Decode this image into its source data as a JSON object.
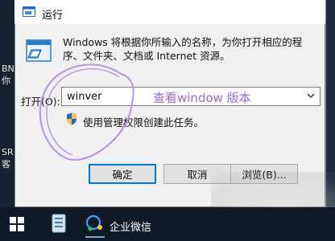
{
  "background": {
    "left_fragments": [
      "BN",
      "你",
      "SR",
      "客"
    ]
  },
  "dialog": {
    "title": "运行",
    "description": "Windows 将根据你所输入的名称，为你打开相应的程序、文件夹、文档或 Internet 资源。",
    "open_label": "打开(O):",
    "input_value": "winver",
    "admin_note": "使用管理权限创建此任务。",
    "buttons": {
      "ok": "确定",
      "cancel": "取消",
      "browse": "浏览(B)..."
    }
  },
  "annotation": {
    "text": "查看window 版本",
    "color": "#9b6bd3"
  },
  "taskbar": {
    "wecom_label": "企业微信"
  },
  "icons": [
    "run-title-icon",
    "run-app-icon",
    "dropdown-arrow-icon",
    "uac-shield-icon",
    "windows-start-icon",
    "app-icon",
    "wecom-icon"
  ]
}
